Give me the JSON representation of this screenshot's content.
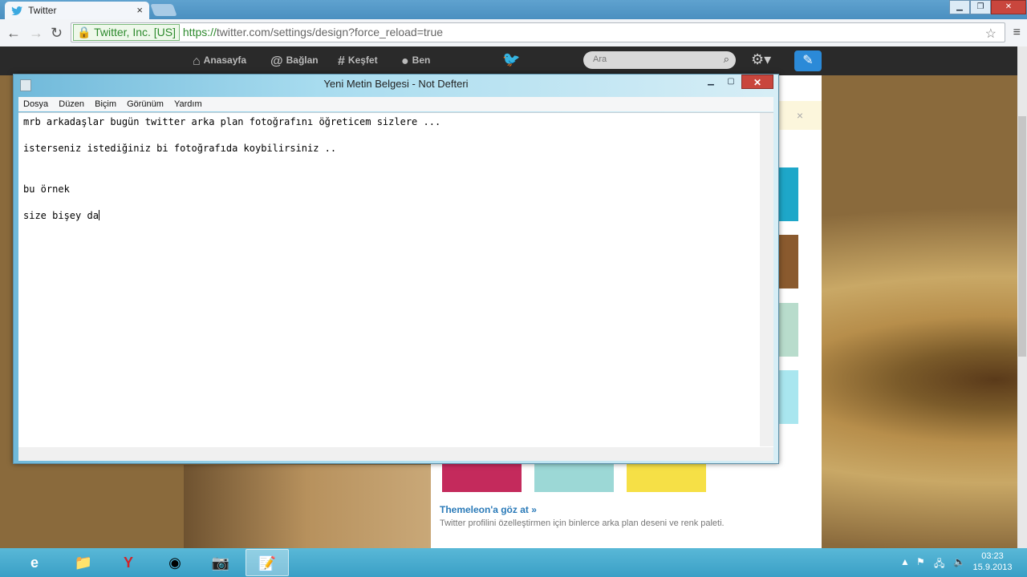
{
  "browser": {
    "tab_title": "Twitter",
    "tab_close": "×",
    "cert_label": "Twitter, Inc. [US]",
    "url_scheme": "https://",
    "url_rest": "twitter.com/settings/design?force_reload=true"
  },
  "twitter_nav": {
    "items": [
      {
        "label": "Anasayfa",
        "icon": "home-icon"
      },
      {
        "label": "Bağlan",
        "icon": "at-icon"
      },
      {
        "label": "Keşfet",
        "icon": "hashtag-icon"
      },
      {
        "label": "Ben",
        "icon": "user-icon"
      }
    ],
    "search_placeholder": "Ara"
  },
  "design_panel": {
    "themeleon_link": "Themeleon'a göz at »",
    "themeleon_desc": "Twitter profilini özelleştirmen için binlerce arka plan deseni ve renk paleti.",
    "alert_close": "×"
  },
  "notepad": {
    "title": "Yeni Metin Belgesi - Not Defteri",
    "menu": [
      "Dosya",
      "Düzen",
      "Biçim",
      "Görünüm",
      "Yardım"
    ],
    "lines": [
      "mrb arkadaşlar bugün twitter arka plan fotoğrafını öğreticem sizlere ...",
      "isterseniz istediğiniz bi fotoğrafıda koybilirsiniz ..",
      "bu örnek",
      "size bişey da"
    ]
  },
  "taskbar": {
    "clock_time": "03:23",
    "clock_date": "15.9.2013"
  },
  "colors": {
    "chrome_tabstrip": "#4a8fc0",
    "twitter_bar": "#2a2a2a",
    "compose_button": "#2b8ad8",
    "taskbar": "#3a9fc6"
  }
}
